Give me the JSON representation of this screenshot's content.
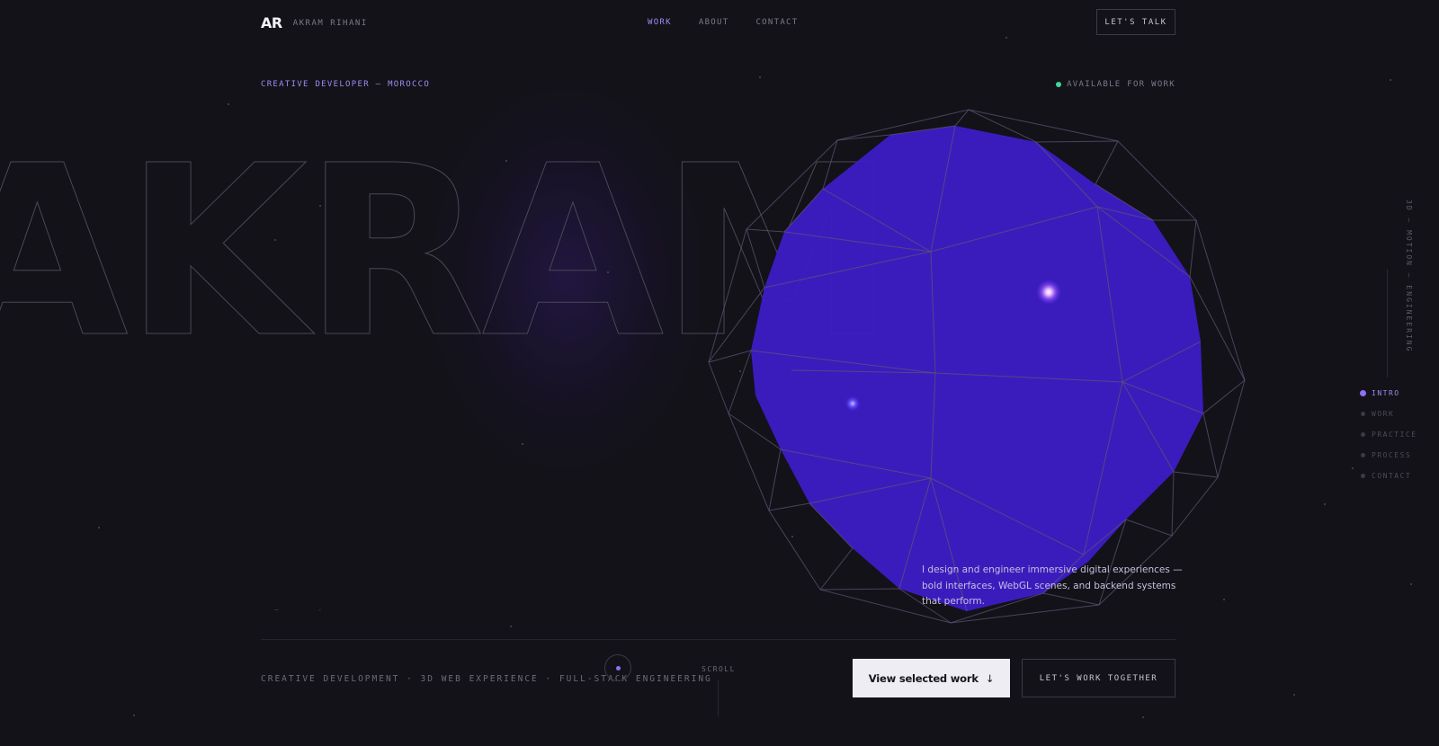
{
  "nav": {
    "logo_mark": "AR",
    "logo_name": "AKRAM RIHANI",
    "links": [
      {
        "label": "WORK",
        "active": true
      },
      {
        "label": "ABOUT",
        "active": false
      },
      {
        "label": "CONTACT",
        "active": false
      }
    ],
    "cta_label": "LET'S TALK"
  },
  "hero": {
    "tagline": "CREATIVE DEVELOPER — MOROCCO",
    "availability": "AVAILABLE FOR WORK",
    "big_name": "AKRAM",
    "side_vertical_text": "3D — MOTION — ENGINEERING",
    "intro": "I design and engineer immersive digital experiences — bold interfaces, WebGL scenes, and backend systems that perform."
  },
  "section_nav": [
    {
      "label": "INTRO",
      "active": true
    },
    {
      "label": "WORK",
      "active": false
    },
    {
      "label": "PRACTICE",
      "active": false
    },
    {
      "label": "PROCESS",
      "active": false
    },
    {
      "label": "CONTACT",
      "active": false
    }
  ],
  "footer": {
    "skills": "CREATIVE DEVELOPMENT · 3D WEB EXPERIENCE · FULL-STACK ENGINEERING",
    "scroll_label": "SCROLL",
    "primary_button": "View selected work",
    "primary_arrow": "↓",
    "secondary_button": "LET'S WORK TOGETHER"
  },
  "colors": {
    "background": "#131218",
    "accent": "#9d8cf5",
    "orb": "#3c1dc4",
    "available_dot": "#3ed89a"
  }
}
